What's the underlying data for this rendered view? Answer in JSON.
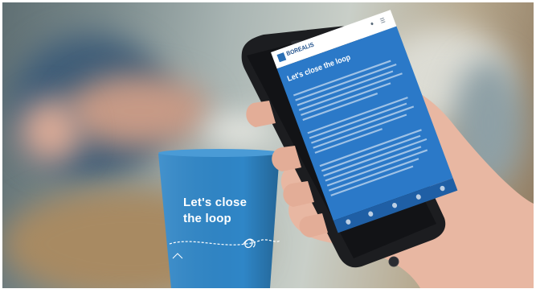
{
  "cup": {
    "line1": "Let's close",
    "line2": "the loop"
  },
  "phone": {
    "brand": "BOREALIS",
    "heading": "Let's close the loop"
  },
  "colors": {
    "cup_blue": "#2f86c7",
    "screen_blue": "#2b79c8",
    "phone_body": "#1c1d20"
  }
}
